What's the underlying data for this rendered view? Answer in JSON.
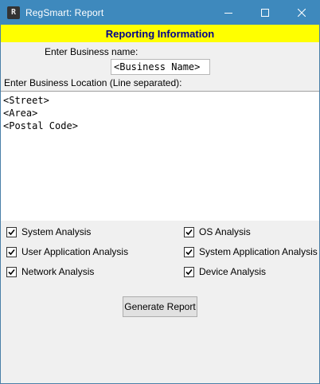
{
  "window": {
    "title": "RegSmart: Report",
    "app_icon": "R"
  },
  "banner": {
    "title": "Reporting Information",
    "background": "#ffff00",
    "color": "#00008b"
  },
  "business_name": {
    "label": "Enter Business name:",
    "value": "<Business Name>"
  },
  "business_location": {
    "label": "Enter Business Location (Line separated):",
    "value": "<Street>\n<Area>\n<Postal Code>"
  },
  "options": [
    {
      "label": "System Analysis",
      "checked": true
    },
    {
      "label": "OS Analysis",
      "checked": true
    },
    {
      "label": "User Application Analysis",
      "checked": true
    },
    {
      "label": "System Application Analysis",
      "checked": true
    },
    {
      "label": "Network Analysis",
      "checked": true
    },
    {
      "label": "Device Analysis",
      "checked": true
    }
  ],
  "actions": {
    "generate_label": "Generate Report"
  },
  "colors": {
    "titlebar": "#3e89bd",
    "window_bg": "#f0f0f0"
  }
}
